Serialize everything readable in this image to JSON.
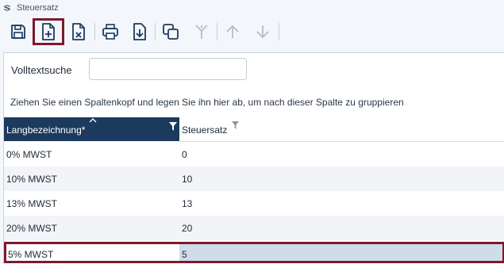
{
  "window": {
    "title": "Steuersatz",
    "app_icon": "app-logo-icon"
  },
  "toolbar": {
    "buttons": [
      {
        "icon": "save-icon",
        "enabled": true
      },
      {
        "icon": "new-document-icon",
        "enabled": true,
        "selected": true
      },
      {
        "icon": "delete-document-icon",
        "enabled": true
      },
      {
        "icon": "print-icon",
        "enabled": true
      },
      {
        "icon": "export-icon",
        "enabled": true
      },
      {
        "icon": "copy-icon",
        "enabled": true
      },
      {
        "icon": "merge-icon",
        "enabled": false
      },
      {
        "icon": "arrow-up-icon",
        "enabled": false
      },
      {
        "icon": "arrow-down-icon",
        "enabled": false
      }
    ]
  },
  "search": {
    "label": "Volltextsuche",
    "value": "",
    "placeholder": ""
  },
  "group_hint": "Ziehen Sie einen Spaltenkopf und legen Sie ihn hier ab, um nach dieser Spalte zu gruppieren",
  "grid": {
    "columns": [
      {
        "label": "Langbezeichnung*",
        "sorted": "ascending",
        "filter_icon": "filter-icon"
      },
      {
        "label": "Steuersatz",
        "filter_icon": "filter-icon"
      }
    ],
    "rows": [
      {
        "langbezeichnung": "0% MWST",
        "steuersatz": "0"
      },
      {
        "langbezeichnung": "10% MWST",
        "steuersatz": "10"
      },
      {
        "langbezeichnung": "13% MWST",
        "steuersatz": "13"
      },
      {
        "langbezeichnung": "20% MWST",
        "steuersatz": "20"
      },
      {
        "langbezeichnung": "5% MWST",
        "steuersatz": "5",
        "selected": true
      }
    ]
  },
  "colors": {
    "header_bg": "#1c3a5e",
    "highlight_border": "#7b1a2c",
    "selected_cell": "#cfdcea",
    "alt_row": "#f2f4f7"
  }
}
